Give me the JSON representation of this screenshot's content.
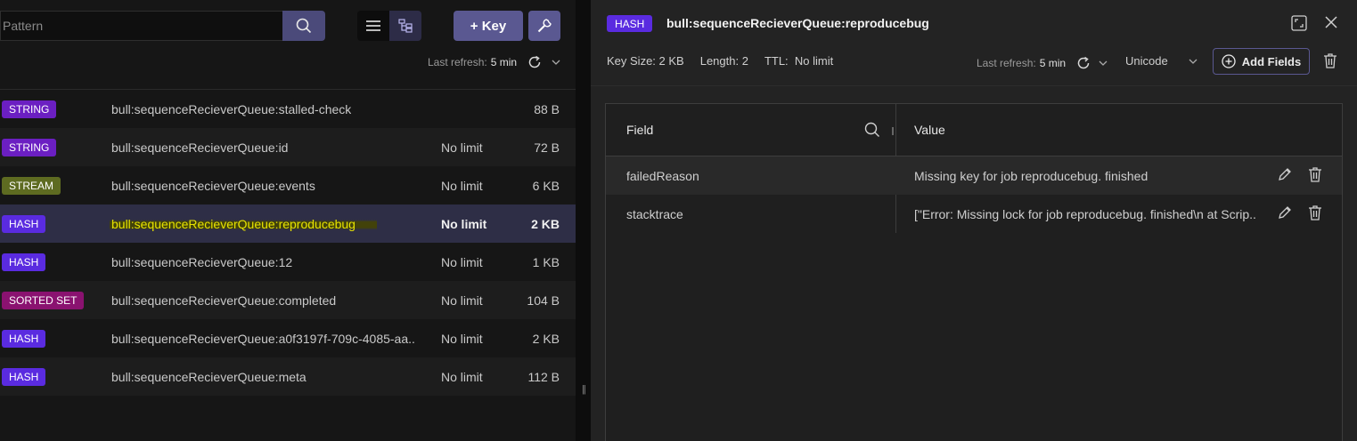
{
  "search": {
    "placeholder": "Pattern"
  },
  "toolbar": {
    "add_key_label": "+ Key"
  },
  "list_refresh": {
    "label": "Last refresh:",
    "value": "5 min"
  },
  "keys": [
    {
      "type": "STRING",
      "type_color": "#6b1fc2",
      "name": "bull:sequenceRecieverQueue:stalled-check",
      "ttl": "",
      "size": "88 B"
    },
    {
      "type": "STRING",
      "type_color": "#6b1fc2",
      "name": "bull:sequenceRecieverQueue:id",
      "ttl": "No limit",
      "size": "72 B"
    },
    {
      "type": "STREAM",
      "type_color": "#5e6b21",
      "name": "bull:sequenceRecieverQueue:events",
      "ttl": "No limit",
      "size": "6 KB"
    },
    {
      "type": "HASH",
      "type_color": "#5a2be0",
      "name": "bull:sequenceRecieverQueue:reproducebug",
      "ttl": "No limit",
      "size": "2 KB"
    },
    {
      "type": "HASH",
      "type_color": "#5a2be0",
      "name": "bull:sequenceRecieverQueue:12",
      "ttl": "No limit",
      "size": "1 KB"
    },
    {
      "type": "SORTED SET",
      "type_color": "#8a1270",
      "name": "bull:sequenceRecieverQueue:completed",
      "ttl": "No limit",
      "size": "104 B"
    },
    {
      "type": "HASH",
      "type_color": "#5a2be0",
      "name": "bull:sequenceRecieverQueue:a0f3197f-709c-4085-aa...",
      "ttl": "No limit",
      "size": "2 KB"
    },
    {
      "type": "HASH",
      "type_color": "#5a2be0",
      "name": "bull:sequenceRecieverQueue:meta",
      "ttl": "No limit",
      "size": "112 B"
    }
  ],
  "detail": {
    "type": "HASH",
    "key": "bull:sequenceRecieverQueue:reproducebug",
    "key_size": "Key Size: 2 KB",
    "length": "Length: 2",
    "ttl": "TTL:  No limit",
    "refresh_label": "Last refresh:",
    "refresh_value": "5 min",
    "encoding": "Unicode",
    "add_fields_label": "Add Fields",
    "columns": {
      "field": "Field",
      "value": "Value"
    },
    "rows": [
      {
        "field": "failedReason",
        "value": "Missing key for job reproducebug. finished"
      },
      {
        "field": "stacktrace",
        "value": "[\"Error: Missing lock for job reproducebug. finished\\n at Scrip..."
      }
    ]
  },
  "icons": {
    "search": "search-icon",
    "list_view": "list-view-icon",
    "tree_view": "tree-view-icon",
    "wrench": "wrench-icon",
    "refresh": "refresh-icon",
    "chevron": "chevron-down-icon",
    "maximize": "maximize-icon",
    "close": "close-icon",
    "add": "plus-circle-icon",
    "trash": "trash-icon",
    "edit": "pencil-icon"
  },
  "colors": {
    "accent": "#5a5891",
    "selected_row": "#2e2e46",
    "highlight_text": "#e6e200"
  }
}
